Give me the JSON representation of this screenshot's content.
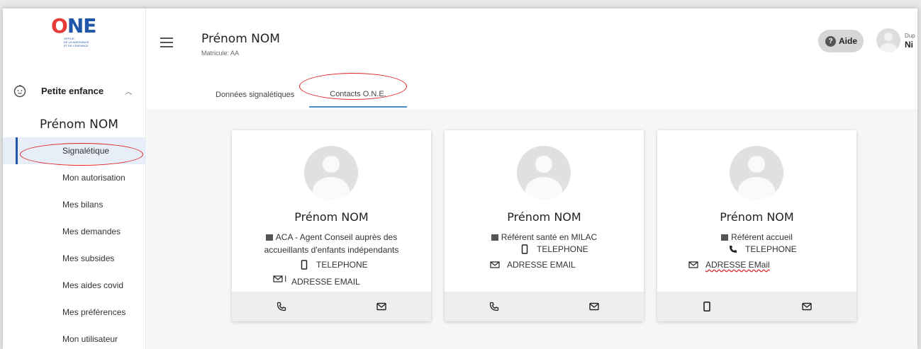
{
  "logo": {
    "brand": "ONE",
    "subtitle": "OFFICE DE LA NAISSANCE ET DE L'ENFANCE"
  },
  "sidebar": {
    "section_label": "Petite enfance",
    "person_name": "Prénom NOM",
    "items": [
      {
        "label": "Signalétique",
        "active": true
      },
      {
        "label": "Mon autorisation"
      },
      {
        "label": "Mes bilans"
      },
      {
        "label": "Mes demandes"
      },
      {
        "label": "Mes subsides"
      },
      {
        "label": "Mes aides covid"
      },
      {
        "label": "Mes préférences"
      },
      {
        "label": "Mon utilisateur"
      }
    ]
  },
  "header": {
    "title": "Prénom NOM",
    "matricule": "Matricule: AA",
    "aide_label": "Aide",
    "user_top": "Dup",
    "user_bottom": "Ni"
  },
  "tabs": [
    {
      "label": "Données signalétiques",
      "active": false
    },
    {
      "label": "Contacts O.N.E.",
      "active": true
    }
  ],
  "cards": [
    {
      "name": "Prénom NOM",
      "role": "ACA - Agent Conseil auprès des accueillants d'enfants indépendants",
      "phone": "TELEPHONE",
      "email": "ADRESSE EMAIL",
      "email_prefix": "I"
    },
    {
      "name": "Prénom NOM",
      "role": "Référent santé en MILAC",
      "phone": "TELEPHONE",
      "email": "ADRESSE EMAIL"
    },
    {
      "name": "Prénom NOM",
      "role": "Référent accueil",
      "phone": "TELEPHONE",
      "email": "ADRESSE EMail"
    }
  ],
  "colors": {
    "accent": "#1f56a8",
    "annotation": "#e02020",
    "tab_underline": "#4a90c8"
  }
}
